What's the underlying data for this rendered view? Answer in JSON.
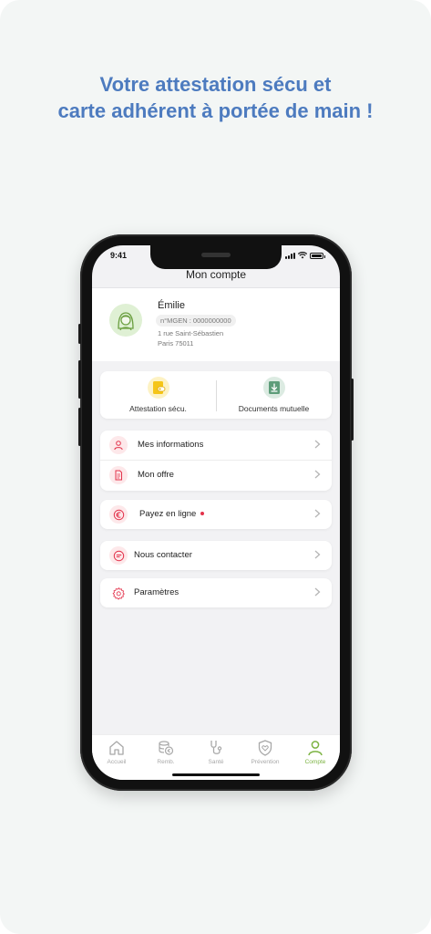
{
  "headline": {
    "line1": "Votre attestation sécu et",
    "line2": "carte adhérent à portée de main !"
  },
  "status": {
    "time": "9:41"
  },
  "screen": {
    "title": "Mon compte"
  },
  "profile": {
    "name": "Émilie",
    "member_number": "n°MGEN : 0000000000",
    "address_line1": "1 rue Saint-Sébastien",
    "address_line2": "Paris 75011"
  },
  "shortcuts": [
    {
      "label": "Attestation sécu.",
      "icon": "id-card-icon",
      "color": "#f5c518"
    },
    {
      "label": "Documents mutuelle",
      "icon": "download-icon",
      "color": "#5e9d7a"
    }
  ],
  "menu": {
    "group1": [
      {
        "label": "Mes informations",
        "icon": "user-icon"
      },
      {
        "label": "Mon offre",
        "icon": "document-icon"
      }
    ],
    "group2": [
      {
        "label": "Payez en ligne",
        "icon": "euro-icon",
        "badge": "notification-dot"
      }
    ],
    "group3": [
      {
        "label": "Nous contacter",
        "icon": "chat-icon"
      }
    ],
    "group4": [
      {
        "label": "Paramètres",
        "icon": "gear-icon"
      }
    ]
  },
  "tabs": [
    {
      "label": "Accueil",
      "icon": "home-icon",
      "active": false
    },
    {
      "label": "Remb.",
      "icon": "coins-icon",
      "active": false
    },
    {
      "label": "Santé",
      "icon": "stethoscope-icon",
      "active": false
    },
    {
      "label": "Prévention",
      "icon": "shield-heart-icon",
      "active": false
    },
    {
      "label": "Compte",
      "icon": "account-icon",
      "active": true
    }
  ],
  "colors": {
    "headline": "#4d7bbf",
    "accent_green": "#7cb342",
    "icon_red": "#e3324b",
    "background": "#f3f6f5"
  }
}
